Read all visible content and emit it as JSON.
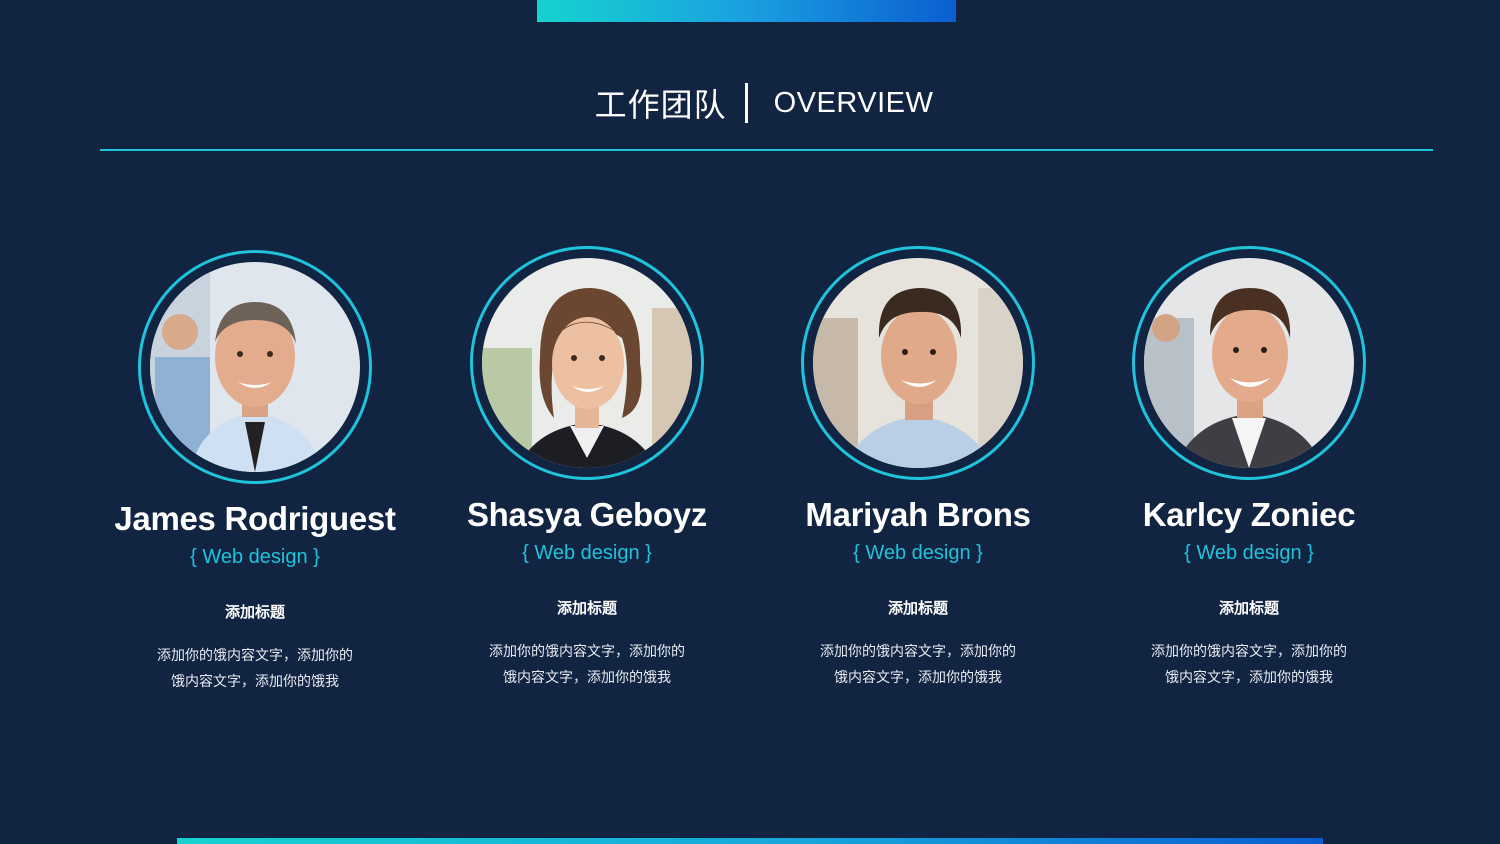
{
  "header": {
    "title_cn": "工作团队",
    "title_en": "OVERVIEW"
  },
  "team": [
    {
      "name": "James Rodriguest",
      "role": "{ Web design }",
      "heading": "添加标题",
      "description": "添加你的饿内容文字，添加你的饿内容文字，添加你的饿我",
      "photo": "man-with-tie-photo"
    },
    {
      "name": "Shasya Geboyz",
      "role": "{ Web design }",
      "heading": "添加标题",
      "description": "添加你的饿内容文字，添加你的饿内容文字，添加你的饿我",
      "photo": "smiling-woman-photo"
    },
    {
      "name": "Mariyah Brons",
      "role": "{ Web design }",
      "heading": "添加标题",
      "description": "添加你的饿内容文字，添加你的饿内容文字，添加你的饿我",
      "photo": "smiling-man-photo"
    },
    {
      "name": "Karlcy Zoniec",
      "role": "{ Web design }",
      "heading": "添加标题",
      "description": "添加你的饿内容文字，添加你的饿内容文字，添加你的饿我",
      "photo": "smiling-man-suit-photo"
    }
  ],
  "colors": {
    "background": "#112441",
    "accent": "#1fc3dc",
    "gradient_start": "#16d3cf",
    "gradient_end": "#0b5ed0"
  }
}
